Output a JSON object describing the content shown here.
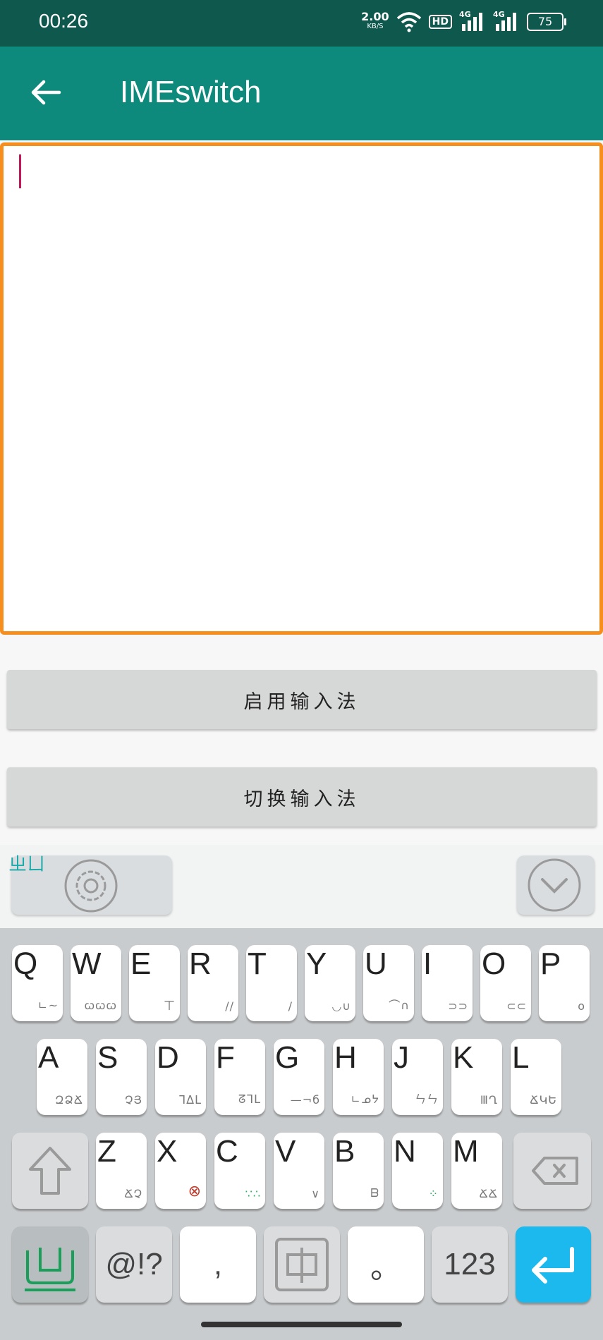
{
  "status": {
    "time": "00:26",
    "speed": "2.00",
    "speed_unit": "KB/S",
    "hd": "HD",
    "net1": "4G",
    "net2": "4G",
    "battery": "75"
  },
  "appbar": {
    "title": "IMEswitch"
  },
  "editor": {
    "value": ""
  },
  "buttons": {
    "enable": "启用输入法",
    "switch": "切换输入法"
  },
  "toolbar": {
    "logo": "ㄓㄩ"
  },
  "keyboard": {
    "row1": [
      {
        "k": "Q",
        "s": "ㄴ~"
      },
      {
        "k": "W",
        "s": "ꞷꞷꞷ"
      },
      {
        "k": "E",
        "s": "ㄒ"
      },
      {
        "k": "R",
        "s": "//"
      },
      {
        "k": "T",
        "s": "/"
      },
      {
        "k": "Y",
        "s": "◡∪"
      },
      {
        "k": "U",
        "s": "⌒∩"
      },
      {
        "k": "I",
        "s": "⊃⊃"
      },
      {
        "k": "O",
        "s": "⊂⊂"
      },
      {
        "k": "P",
        "s": "o"
      }
    ],
    "row2": [
      {
        "k": "A",
        "s": "ԶՁՃ"
      },
      {
        "k": "S",
        "s": "ՉՅ"
      },
      {
        "k": "D",
        "s": "ᒣᐃᒪ"
      },
      {
        "k": "F",
        "s": "ᘔᒣᒪ"
      },
      {
        "k": "G",
        "s": "—¬б"
      },
      {
        "k": "H",
        "s": "ㄴᓄᔭ"
      },
      {
        "k": "J",
        "s": "ㄣㄣ"
      },
      {
        "k": "K",
        "s": "ⅢՂ"
      },
      {
        "k": "L",
        "s": "ՃԿԵ"
      }
    ],
    "row3": [
      {
        "k": "Z",
        "s": "ՃՉ"
      },
      {
        "k": "X",
        "s": "⊗"
      },
      {
        "k": "C",
        "s": "∵∴"
      },
      {
        "k": "V",
        "s": "∨"
      },
      {
        "k": "B",
        "s": "ᗷ"
      },
      {
        "k": "N",
        "s": "⁘"
      },
      {
        "k": "M",
        "s": "ՃՃ"
      }
    ],
    "bottom": {
      "symbols": "@!?",
      "comma": ",",
      "period": "。",
      "numbers": "123"
    }
  }
}
